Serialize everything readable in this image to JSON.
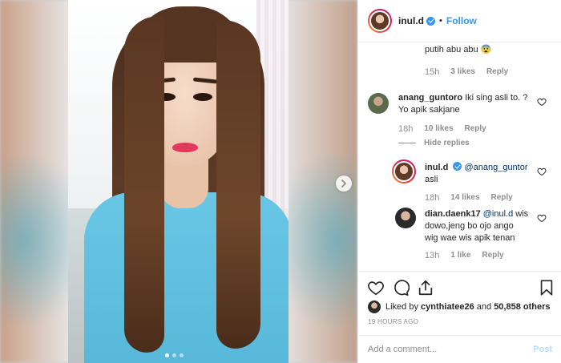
{
  "post": {
    "username": "inul.d",
    "follow_label": "Follow",
    "bullet": "•",
    "carousel": {
      "slide_count": 3,
      "active_index": 0
    }
  },
  "comments": {
    "partial": {
      "line1": "putih abu abu 😨",
      "time": "15h",
      "likes": "3 likes",
      "reply": "Reply"
    },
    "anang": {
      "username": "anang_guntoro",
      "text1": "Iki sing asli to. ?",
      "text2": "Yo apik sakjane",
      "time": "18h",
      "likes": "10 likes",
      "reply": "Reply",
      "hide_replies": "Hide replies"
    },
    "inul_reply": {
      "username": "inul.d",
      "mention": "@anang_guntoro",
      "text": "asli",
      "time": "18h",
      "likes": "14 likes",
      "reply": "Reply"
    },
    "dian": {
      "username": "dian.daenk17",
      "mention": "@inul.d",
      "text1": "wis",
      "text2": "dowo,jeng bo ojo ango",
      "text3": "wig wae wis apik tenan",
      "time": "13h",
      "likes": "1 like",
      "reply": "Reply"
    }
  },
  "actions": {
    "liked_by_prefix": "Liked by",
    "liked_by_user": "cynthiatee26",
    "liked_by_and": "and",
    "liked_by_count": "50,858 others",
    "time_ago": "19 HOURS AGO"
  },
  "composer": {
    "placeholder": "Add a comment...",
    "post_label": "Post"
  },
  "colors": {
    "link": "#3897f0",
    "muted": "#8e8e8e",
    "text": "#262626",
    "post_disabled": "#b2dffc"
  }
}
